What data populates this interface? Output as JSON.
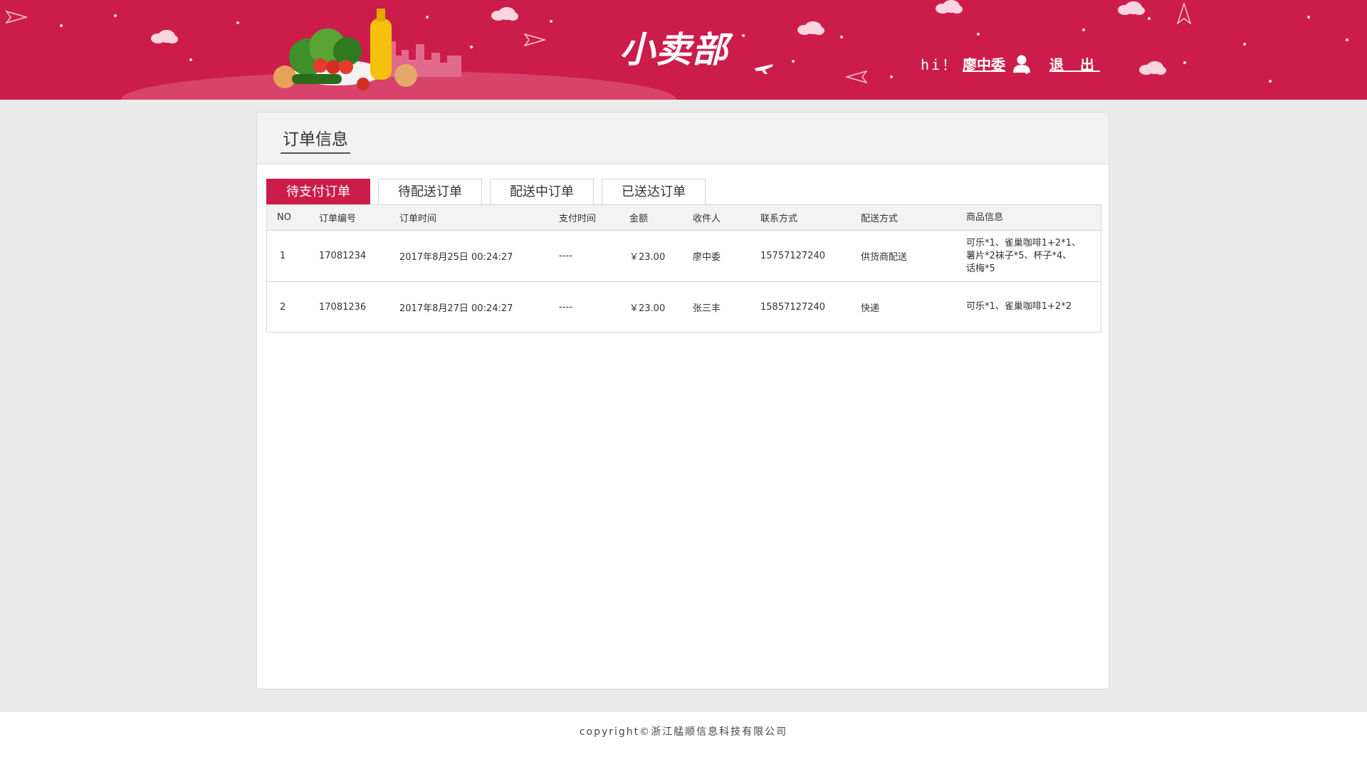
{
  "header": {
    "logo": "小卖部",
    "greeting": "hi！",
    "username": "廖中委",
    "logout_label": "退 出",
    "brand_color": "#cc1d4a",
    "icons": {
      "user": "user-icon"
    }
  },
  "page": {
    "title": "订单信息"
  },
  "tabs": [
    {
      "label": "待支付订单",
      "active": true
    },
    {
      "label": "待配送订单",
      "active": false
    },
    {
      "label": "配送中订单",
      "active": false
    },
    {
      "label": "已送达订单",
      "active": false
    }
  ],
  "table": {
    "columns": [
      "NO",
      "订单编号",
      "订单时间",
      "支付时间",
      "金额",
      "收件人",
      "联系方式",
      "配送方式",
      "商品信息"
    ],
    "rows": [
      [
        "1",
        "17081234",
        "2017年8月25日  00:24:27",
        "----",
        "￥23.00",
        "廖中委",
        "15757127240",
        "供货商配送",
        "可乐*1、雀巢咖啡1+2*1、薯片*2袜子*5、杯子*4、话梅*5"
      ],
      [
        "2",
        "17081236",
        "2017年8月27日  00:24:27",
        "----",
        "￥23.00",
        "张三丰",
        "15857127240",
        "快递",
        "可乐*1、雀巢咖啡1+2*2"
      ]
    ]
  },
  "footer": {
    "copyright": "copyright©浙江艋顺信息科技有限公司"
  }
}
